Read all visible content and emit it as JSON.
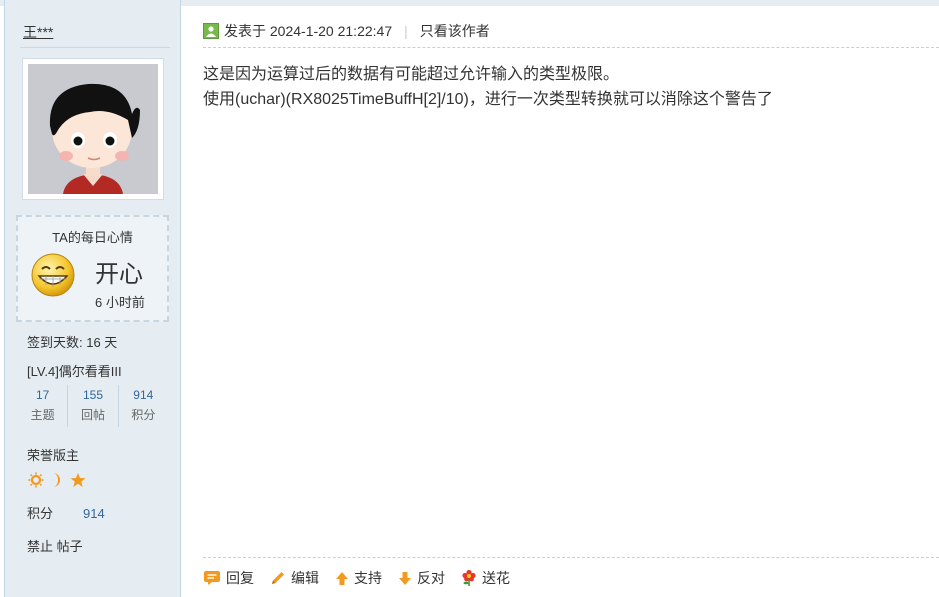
{
  "author": {
    "name": "王***",
    "mood": {
      "title": "TA的每日心情",
      "text": "开心",
      "time": "6 小时前",
      "icon": "grinning-face-icon"
    },
    "checkin": "签到天数: 16 天",
    "level": "[LV.4]偶尔看看III",
    "stats": [
      {
        "value": "17",
        "label": "主题"
      },
      {
        "value": "155",
        "label": "回帖"
      },
      {
        "value": "914",
        "label": "积分"
      }
    ],
    "rank_title": "荣誉版主",
    "points_label": "积分",
    "points_value": "914",
    "banned": "禁止 帖子"
  },
  "post": {
    "posted_label": "发表于",
    "posted_time": "2024-1-20 21:22:47",
    "separator": "|",
    "author_only": "只看该作者",
    "body_lines": [
      "这是因为运算过后的数据有可能超过允许输入的类型极限。",
      "使用(uchar)(RX8025TimeBuffH[2]/10)，进行一次类型转换就可以消除这个警告了"
    ]
  },
  "actions": [
    {
      "name": "reply",
      "label": "回复",
      "icon": "reply-icon"
    },
    {
      "name": "edit",
      "label": "编辑",
      "icon": "pencil-icon"
    },
    {
      "name": "support",
      "label": "支持",
      "icon": "arrow-up-icon"
    },
    {
      "name": "oppose",
      "label": "反对",
      "icon": "arrow-down-icon"
    },
    {
      "name": "flower",
      "label": "送花",
      "icon": "flower-icon"
    }
  ],
  "colors": {
    "sidebar_bg": "#e5edf2",
    "link_blue": "#336699",
    "accent_orange": "#f29a1f"
  }
}
